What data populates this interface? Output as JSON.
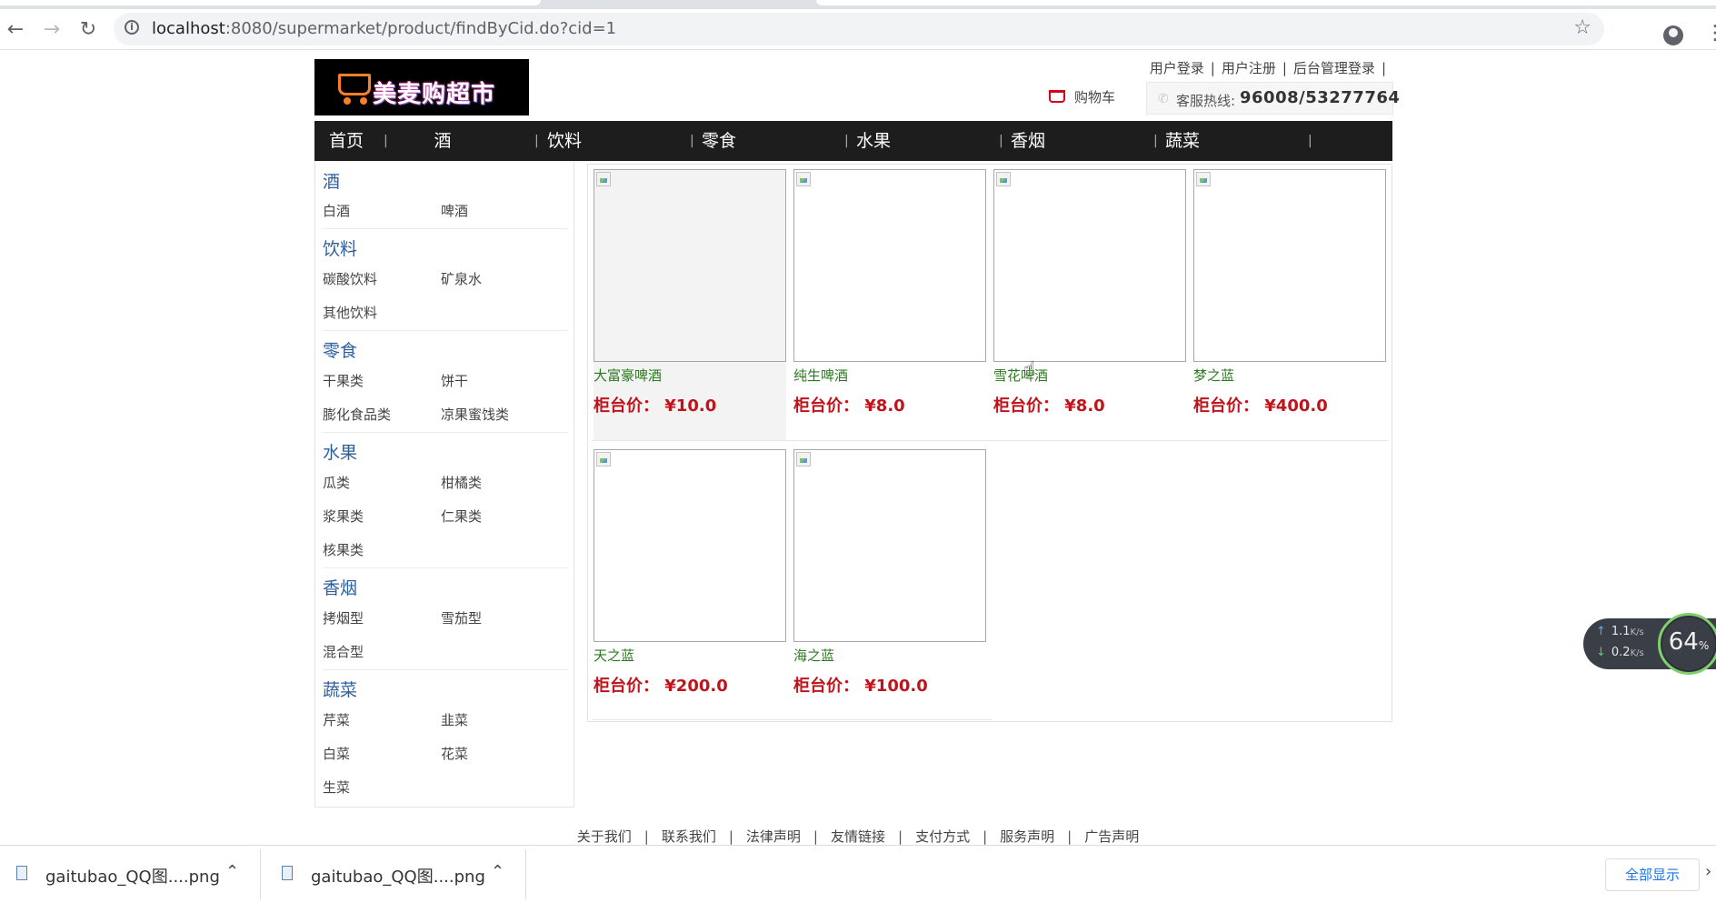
{
  "browser": {
    "url_host": "localhost",
    "url_rest": ":8080/supermarket/product/findByCid.do?cid=1"
  },
  "header": {
    "logo_text": "美麦购超市",
    "top_links": [
      "用户登录",
      "用户注册",
      "后台管理登录"
    ],
    "cart_label": "购物车",
    "hotline_label": "客服热线:",
    "hotline_number": "96008/53277764"
  },
  "nav": [
    "首页",
    "酒",
    "饮料",
    "零食",
    "水果",
    "香烟",
    "蔬菜"
  ],
  "sidebar": [
    {
      "title": "酒",
      "subs": [
        "白酒",
        "啤酒"
      ]
    },
    {
      "title": "饮料",
      "subs": [
        "碳酸饮料",
        "矿泉水",
        "其他饮料"
      ]
    },
    {
      "title": "零食",
      "subs": [
        "干果类",
        "饼干",
        "膨化食品类",
        "凉果蜜饯类"
      ]
    },
    {
      "title": "水果",
      "subs": [
        "瓜类",
        "柑橘类",
        "浆果类",
        "仁果类",
        "核果类"
      ]
    },
    {
      "title": "香烟",
      "subs": [
        "拷烟型",
        "雪茄型",
        "混合型"
      ]
    },
    {
      "title": "蔬菜",
      "subs": [
        "芹菜",
        "韭菜",
        "白菜",
        "花菜",
        "生菜"
      ]
    }
  ],
  "price_label": "柜台价：",
  "products": [
    {
      "name": "大富豪啤酒",
      "price": "¥10.0"
    },
    {
      "name": "纯生啤酒",
      "price": "¥8.0"
    },
    {
      "name": "雪花啤酒",
      "price": "¥8.0"
    },
    {
      "name": "梦之蓝",
      "price": "¥400.0"
    },
    {
      "name": "天之蓝",
      "price": "¥200.0"
    },
    {
      "name": "海之蓝",
      "price": "¥100.0"
    }
  ],
  "footer": [
    "关于我们",
    "联系我们",
    "法律声明",
    "友情链接",
    "支付方式",
    "服务声明",
    "广告声明"
  ],
  "net_widget": {
    "up": "1.1",
    "down": "0.2",
    "unit": "K/s",
    "percent": "64",
    "percent_sign": "%"
  },
  "downloads": {
    "items": [
      "gaitubao_QQ图....png",
      "gaitubao_QQ图....png"
    ],
    "show_all": "全部显示"
  }
}
